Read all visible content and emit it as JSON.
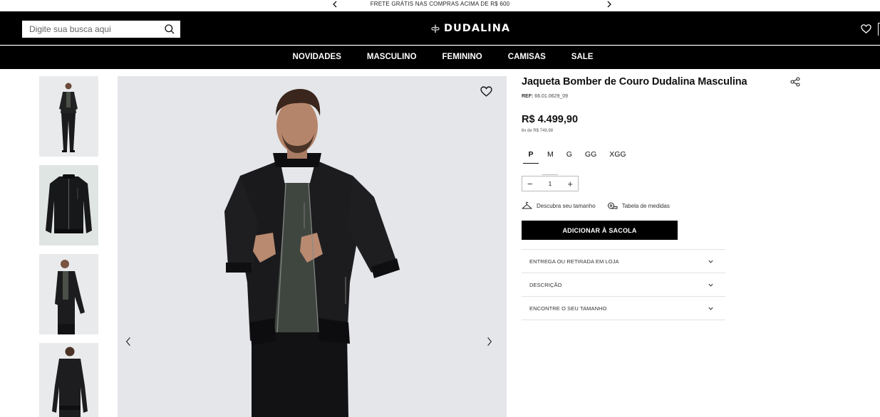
{
  "announcement": {
    "text": "FRETE GRÁTIS NAS COMPRAS ACIMA DE R$ 600"
  },
  "header": {
    "search_placeholder": "Digite sua busca aqui",
    "logo": "DUDALINA"
  },
  "nav": {
    "items": [
      {
        "label": "NOVIDADES"
      },
      {
        "label": "MASCULINO"
      },
      {
        "label": "FEMININO"
      },
      {
        "label": "CAMISAS"
      },
      {
        "label": "SALE"
      }
    ]
  },
  "product": {
    "title": "Jaqueta Bomber de Couro Dudalina Masculina",
    "ref_label": "REF:",
    "ref_value": "66.01.0629_09",
    "price": "R$ 4.499,90",
    "installments": "6x de R$ 749,98",
    "sizes": [
      {
        "label": "P",
        "selected": true
      },
      {
        "label": "M",
        "selected": false
      },
      {
        "label": "G",
        "selected": false
      },
      {
        "label": "GG",
        "selected": false
      },
      {
        "label": "XGG",
        "selected": false
      }
    ],
    "quantity": "1",
    "find_size_label": "Descubra seu tamanho",
    "size_table_label": "Tabela de medidas",
    "add_to_bag_label": "ADICIONAR À SACOLA",
    "accordion": [
      {
        "label": "ENTREGA OU RETIRADA EM LOJA"
      },
      {
        "label": "DESCRIÇÃO"
      },
      {
        "label": "ENCONTRE O SEU TAMANHO"
      }
    ]
  },
  "icons": {
    "search": "search-icon",
    "favorite": "heart-icon",
    "share": "share-icon",
    "logo_mark": "fleur-de-lis-icon",
    "hanger": "hanger-icon",
    "measuring_tape": "measuring-tape-icon",
    "chevron": "chevron-down-icon"
  },
  "colors": {
    "brand": "#000000",
    "background": "#ffffff",
    "photo_bg": "#e4e6e9"
  }
}
